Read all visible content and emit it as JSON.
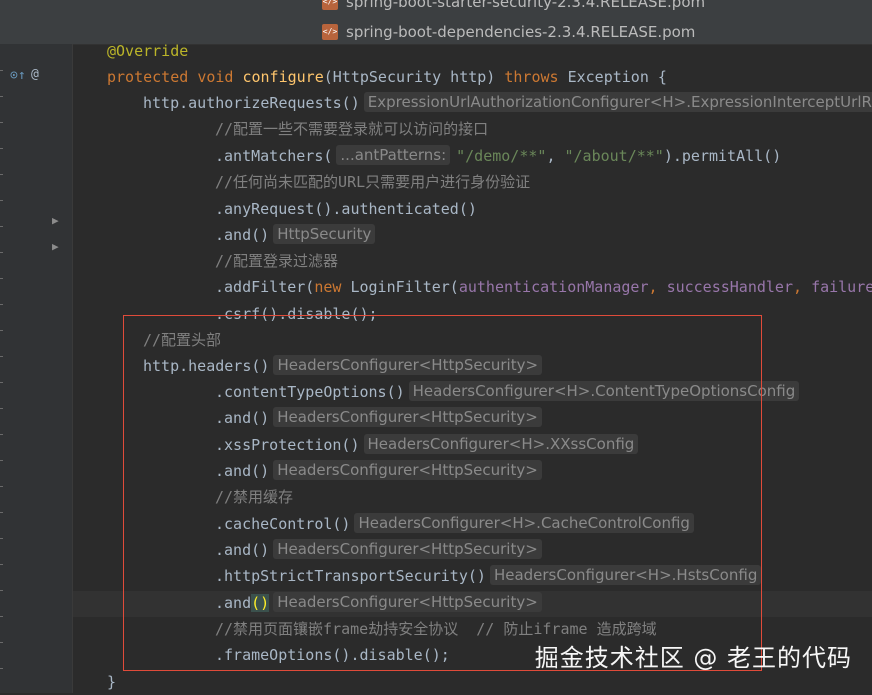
{
  "tabs": [
    {
      "label": "spring-boot-starter-security-2.3.4.RELEASE.pom",
      "icon": "maven-pom-file-icon"
    },
    {
      "label": "spring-boot-dependencies-2.3.4.RELEASE.pom",
      "icon": "maven-pom-file-icon"
    }
  ],
  "file_icon_text": "</>",
  "gutter": {
    "override_icon": "override-method-icon",
    "override_glyph": "⊙↑",
    "at_glyph": "@",
    "fold_glyph": "▶"
  },
  "code": {
    "l0": {
      "annotation": "@Override"
    },
    "l1": {
      "kw_protected": "protected",
      "kw_void": "void",
      "method": "configure",
      "sig": "(HttpSecurity http) ",
      "kw_throws": "throws",
      "exc": " Exception {"
    },
    "l2": {
      "code": "http.authorizeRequests()",
      "hint": "ExpressionUrlAuthorizationConfigurer<H>.ExpressionInterceptUrlR"
    },
    "l3": {
      "comment": "//配置一些不需要登录就可以访问的接口"
    },
    "l4": {
      "pre": ".antMatchers(",
      "hint": "...antPatterns:",
      "str1": "\"/demo/**\"",
      "sep": ", ",
      "str2": "\"/about/**\"",
      "post": ").permitAll()"
    },
    "l5": {
      "comment": "//任何尚未匹配的URL只需要用户进行身份验证"
    },
    "l6": {
      "code": ".anyRequest().authenticated()"
    },
    "l7": {
      "code": ".and()",
      "hint": "HttpSecurity"
    },
    "l8": {
      "comment": "//配置登录过滤器"
    },
    "l9": {
      "pre": ".addFilter(",
      "kw_new": "new",
      "cls": " LoginFilter(",
      "f1": "authenticationManager",
      "sep1": ", ",
      "f2": "successHandler",
      "sep2": ", ",
      "f3": "failure"
    },
    "l10": {
      "code": ".csrf().disable();"
    },
    "l11": {
      "comment": "//配置头部"
    },
    "l12": {
      "code": "http.headers()",
      "hint": "HeadersConfigurer<HttpSecurity>"
    },
    "l13": {
      "code": ".contentTypeOptions()",
      "hint": "HeadersConfigurer<H>.ContentTypeOptionsConfig"
    },
    "l14": {
      "code": ".and()",
      "hint": "HeadersConfigurer<HttpSecurity>"
    },
    "l15": {
      "code": ".xssProtection()",
      "hint": "HeadersConfigurer<H>.XXssConfig"
    },
    "l16": {
      "code": ".and()",
      "hint": "HeadersConfigurer<HttpSecurity>"
    },
    "l17": {
      "comment": "//禁用缓存"
    },
    "l18": {
      "code": ".cacheControl()",
      "hint": "HeadersConfigurer<H>.CacheControlConfig"
    },
    "l19": {
      "code": ".and()",
      "hint": "HeadersConfigurer<HttpSecurity>"
    },
    "l20": {
      "code": ".httpStrictTransportSecurity()",
      "hint": "HeadersConfigurer<H>.HstsConfig"
    },
    "l21": {
      "pre": ".and",
      "paren": "()",
      "hint": "HeadersConfigurer<HttpSecurity>"
    },
    "l22": {
      "comment": "//禁用页面镶嵌frame劫持安全协议  // 防止iframe 造成跨域"
    },
    "l23": {
      "code": ".frameOptions().disable();"
    },
    "l24": {
      "code": "}"
    }
  },
  "watermark": "掘金技术社区 @ 老王的代码",
  "colors": {
    "editor_bg": "#2b2b2b",
    "keyword": "#cc7832",
    "method": "#ffc66d",
    "string": "#6a8759",
    "comment": "#808080",
    "field": "#9876aa",
    "annotation": "#bbb529",
    "highlight_box": "#e04b3a"
  }
}
